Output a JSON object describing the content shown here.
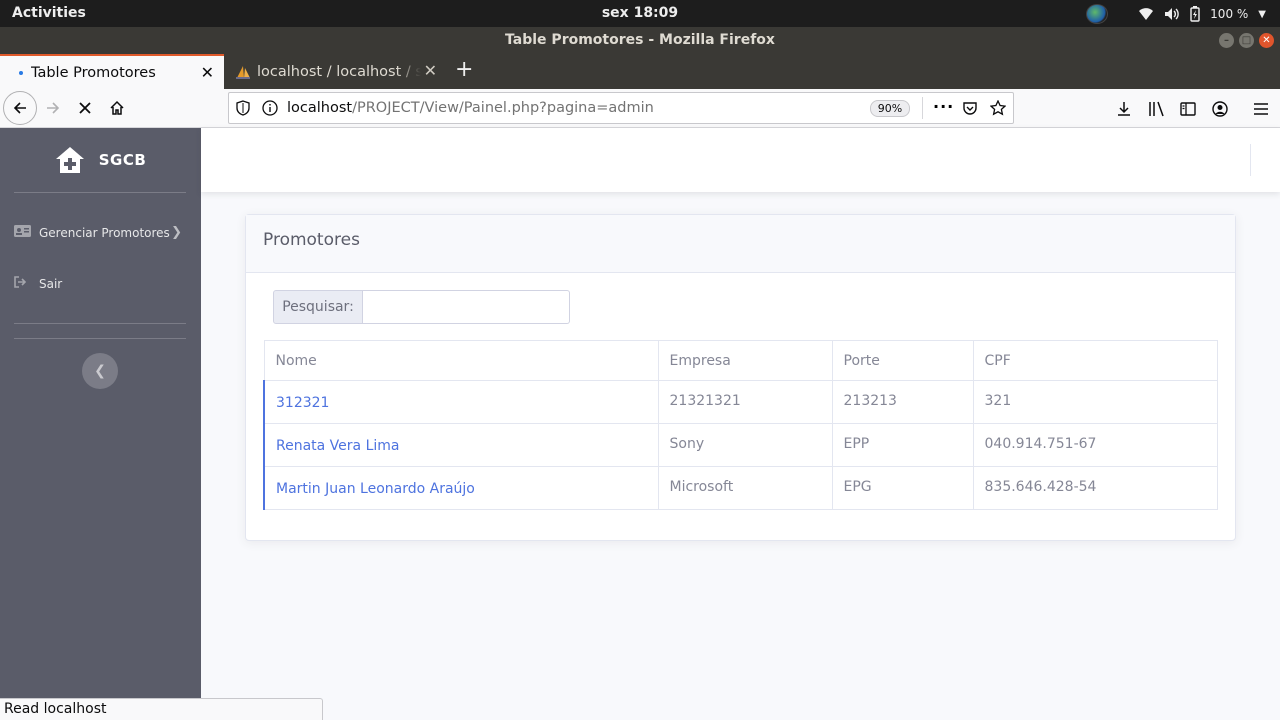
{
  "gnome": {
    "activities": "Activities",
    "clock": "sex 18:09",
    "battery": "100 %"
  },
  "window": {
    "title": "Table Promotores - Mozilla Firefox"
  },
  "tabs": [
    {
      "label": "Table Promotores",
      "active": true
    },
    {
      "label": "localhost / localhost / sc",
      "active": false
    }
  ],
  "toolbar": {
    "url_host": "localhost",
    "url_path": "/PROJECT/View/Painel.php?pagina=admin",
    "zoom": "90%"
  },
  "sidebar": {
    "brand": "SGCB",
    "items": [
      {
        "label": "Gerenciar Promotores",
        "icon": "id-card-icon"
      },
      {
        "label": "Sair",
        "icon": "sign-out-icon"
      }
    ]
  },
  "card": {
    "title": "Promotores",
    "search_label": "Pesquisar:",
    "search_value": ""
  },
  "table": {
    "headers": [
      "Nome",
      "Empresa",
      "Porte",
      "CPF"
    ],
    "rows": [
      [
        "312321",
        "21321321",
        "213213",
        "321"
      ],
      [
        "Renata Vera Lima",
        "Sony",
        "EPP",
        "040.914.751-67"
      ],
      [
        "Martin Juan Leonardo Araújo",
        "Microsoft",
        "EPG",
        "835.646.428-54"
      ]
    ]
  },
  "statusbar": {
    "text": "Read localhost"
  },
  "colors": {
    "sidebar": "#5a5c69",
    "primary": "#4e73df",
    "firefox_accent": "#e05a2b"
  }
}
